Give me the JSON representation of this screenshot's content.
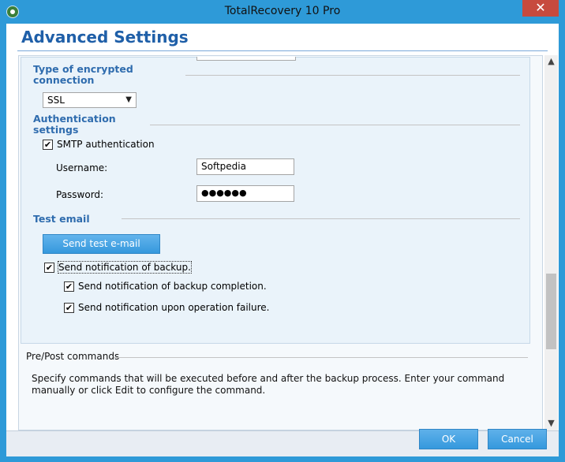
{
  "window": {
    "title": "TotalRecovery 10 Pro",
    "close_glyph": "✕"
  },
  "header": {
    "title": "Advanced Settings"
  },
  "connection": {
    "heading": "Type of encrypted connection",
    "select_value": "SSL"
  },
  "auth": {
    "heading": "Authentication settings",
    "smtp_auth_label": "SMTP authentication",
    "smtp_auth_checked": true,
    "username_label": "Username:",
    "username_value": "Softpedia",
    "password_label": "Password:",
    "password_value": "●●●●●●"
  },
  "test_email": {
    "heading": "Test email",
    "send_button": "Send test e-mail"
  },
  "notifications": {
    "send_backup_label": "Send notification of backup.",
    "completion_label": "Send notification of backup completion.",
    "failure_label": "Send notification upon operation failure."
  },
  "prepost": {
    "title": "Pre/Post commands",
    "description": "Specify commands that will be executed before and after the backup process. Enter your command manually or click Edit to configure the command."
  },
  "footer": {
    "ok_label": "OK",
    "cancel_label": "Cancel"
  },
  "icons": {
    "check": "✔",
    "dropdown": "▼",
    "scroll_up": "▲",
    "scroll_down": "▼"
  },
  "colors": {
    "accent": "#2e9ad8",
    "heading": "#2f6cae",
    "close": "#c74a3e"
  }
}
